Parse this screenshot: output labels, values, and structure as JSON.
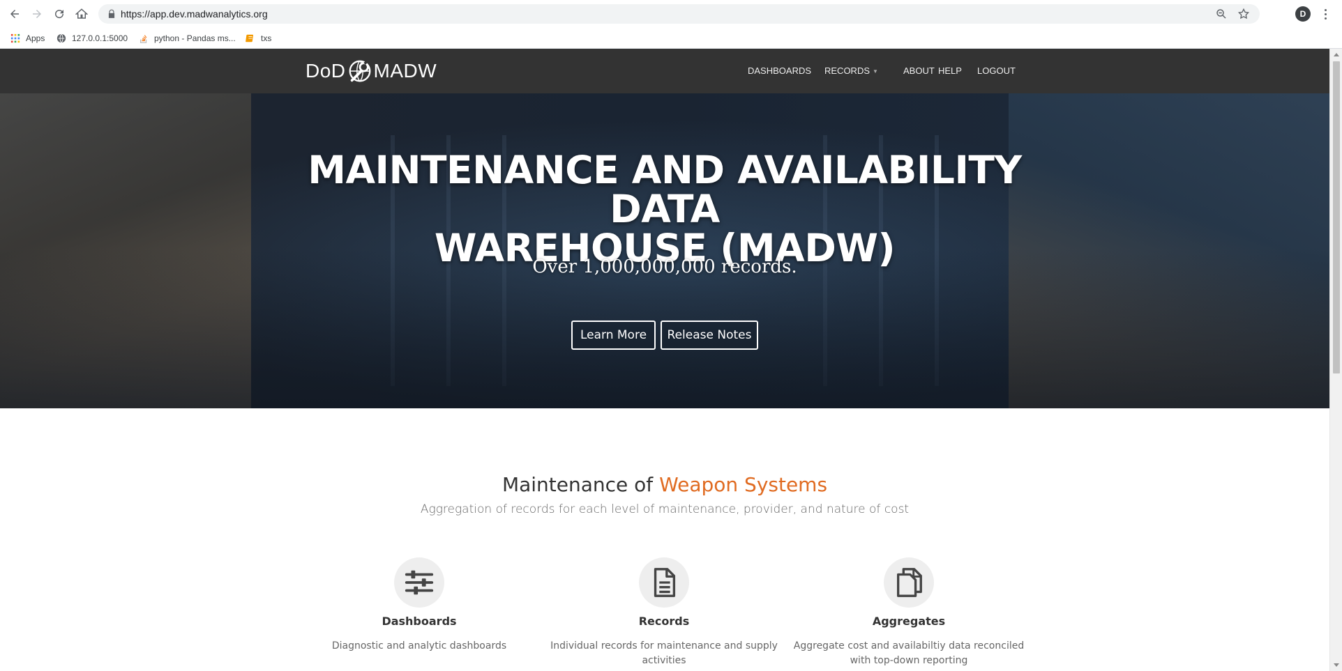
{
  "browser": {
    "url": "https://app.dev.madwanalytics.org",
    "profile_initial": "D",
    "bookmarks": [
      {
        "label": "Apps",
        "icon": "apps-grid-icon"
      },
      {
        "label": "127.0.0.1:5000",
        "icon": "globe-icon"
      },
      {
        "label": "python - Pandas ms...",
        "icon": "stackoverflow-icon"
      },
      {
        "label": "txs",
        "icon": "book-icon"
      }
    ]
  },
  "site": {
    "brand_left": "DoD",
    "brand_right": "MADW",
    "nav": [
      {
        "label": "DASHBOARDS"
      },
      {
        "label": "RECORDS",
        "has_dropdown": true
      },
      {
        "label": "ABOUT"
      },
      {
        "label": "HELP"
      },
      {
        "label": "LOGOUT"
      }
    ]
  },
  "hero": {
    "title_line1": "MAINTENANCE AND AVAILABILITY DATA",
    "title_line2": "WAREHOUSE (MADW)",
    "subtitle": "Over 1,000,000,000 records.",
    "learn_more": "Learn More",
    "release_notes": "Release Notes"
  },
  "section": {
    "title_prefix": "Maintenance of",
    "title_accent": "Weapon Systems",
    "subtitle": "Aggregation of records for each level of maintenance, provider, and nature of cost",
    "accent_color": "#e06b21"
  },
  "features": [
    {
      "title": "Dashboards",
      "desc": "Diagnostic and analytic dashboards",
      "icon": "sliders-icon"
    },
    {
      "title": "Records",
      "desc": "Individual records for maintenance and supply activities",
      "icon": "document-icon"
    },
    {
      "title": "Aggregates",
      "desc": "Aggregate cost and availabiltiy data reconciled with top-down reporting",
      "icon": "copy-icon"
    }
  ]
}
